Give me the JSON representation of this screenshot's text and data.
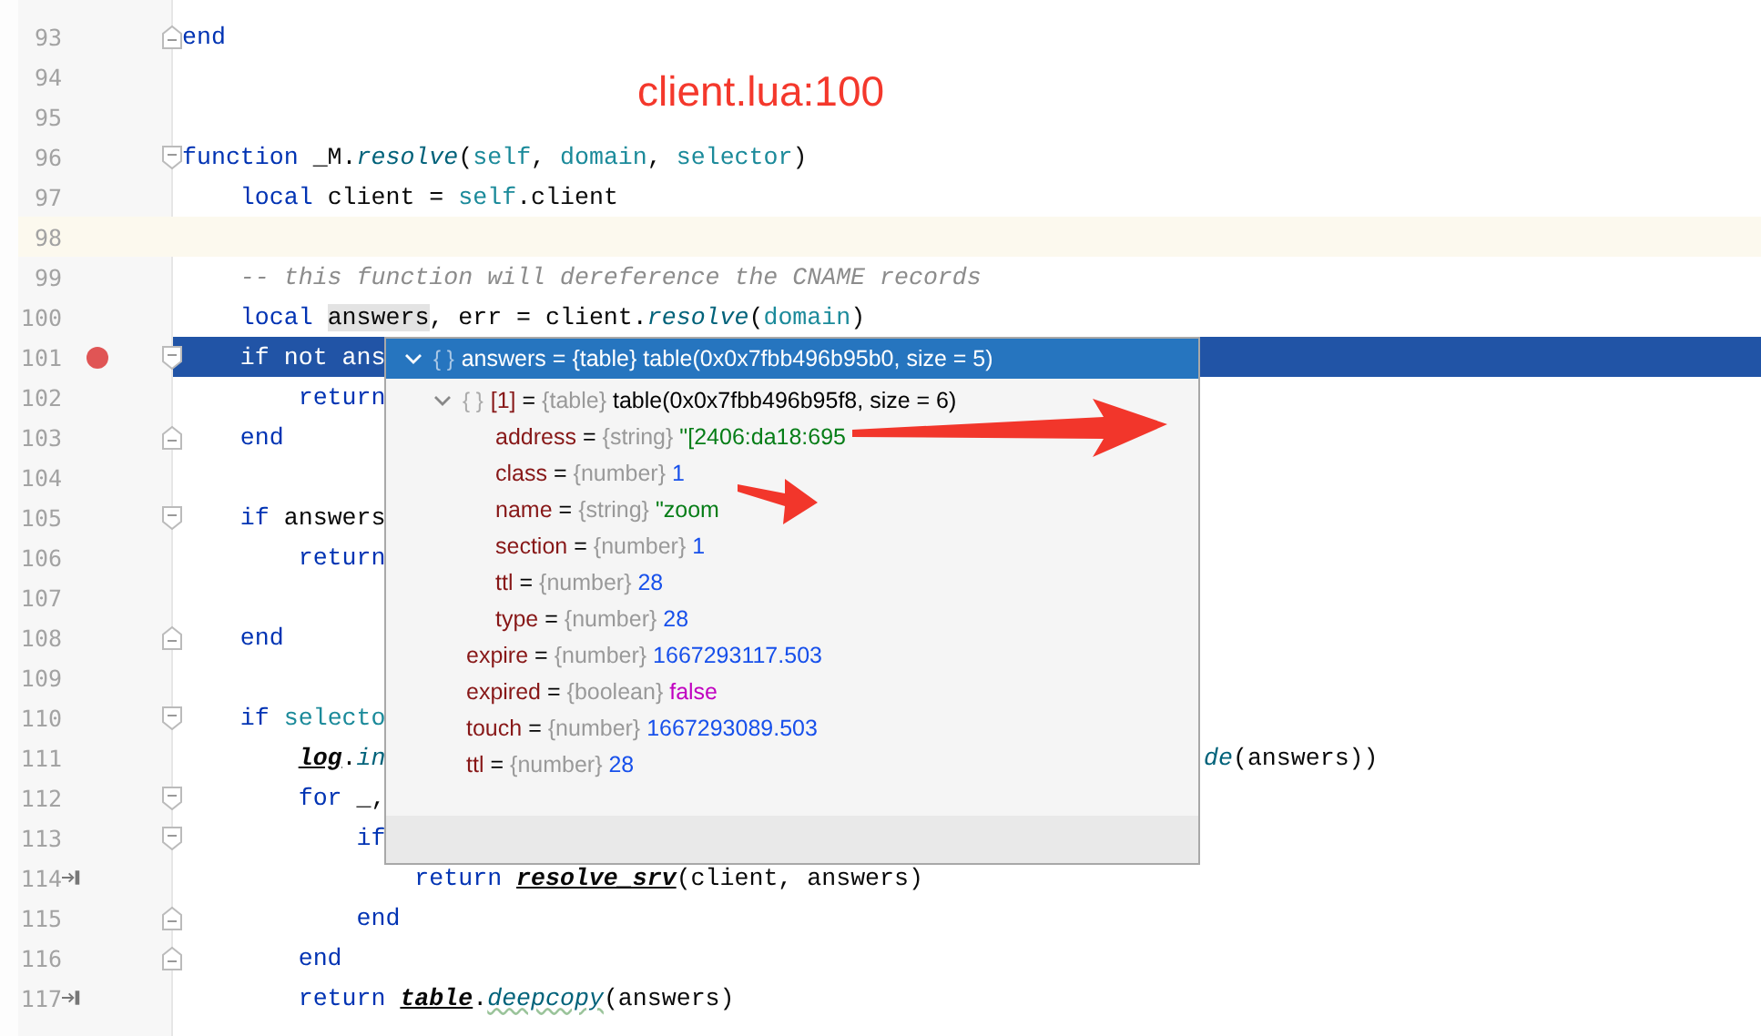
{
  "editor": {
    "lines": [
      {
        "num": "93",
        "kind": "plain",
        "icons": [
          {
            "kind": "fold-end"
          }
        ],
        "tokens": [
          {
            "kind": "kw",
            "text": "end"
          }
        ]
      },
      {
        "num": "94",
        "kind": "plain"
      },
      {
        "num": "95",
        "kind": "plain"
      },
      {
        "num": "96",
        "kind": "plain",
        "icons": [
          {
            "kind": "fold-start"
          }
        ],
        "tokens": [
          {
            "kind": "kw",
            "text": "function "
          },
          {
            "kind": "plain",
            "text": "_M."
          },
          {
            "kind": "fn",
            "text": "resolve"
          },
          {
            "kind": "plain",
            "text": "("
          },
          {
            "kind": "param",
            "text": "self"
          },
          {
            "kind": "plain",
            "text": ", "
          },
          {
            "kind": "param",
            "text": "domain"
          },
          {
            "kind": "plain",
            "text": ", "
          },
          {
            "kind": "param",
            "text": "selector"
          },
          {
            "kind": "plain",
            "text": ")"
          }
        ]
      },
      {
        "num": "97",
        "kind": "plain",
        "tokens": [
          {
            "kind": "kw",
            "text": "    local "
          },
          {
            "kind": "plain",
            "text": "client = "
          },
          {
            "kind": "param",
            "text": "self"
          },
          {
            "kind": "plain",
            "text": ".client"
          }
        ]
      },
      {
        "num": "98",
        "kind": "caret"
      },
      {
        "num": "99",
        "kind": "plain",
        "tokens": [
          {
            "kind": "comment",
            "text": "    -- this function will dereference the CNAME records"
          }
        ]
      },
      {
        "num": "100",
        "kind": "plain",
        "tokens": [
          {
            "kind": "kw",
            "text": "    local "
          },
          {
            "kind": "hl",
            "text": "answers"
          },
          {
            "kind": "plain",
            "text": ", err = client."
          },
          {
            "kind": "fn",
            "text": "resolve"
          },
          {
            "kind": "plain",
            "text": "("
          },
          {
            "kind": "param",
            "text": "domain"
          },
          {
            "kind": "plain",
            "text": ")"
          }
        ]
      },
      {
        "num": "101",
        "kind": "execution",
        "icons": [
          {
            "kind": "breakpoint"
          },
          {
            "kind": "fold-start"
          }
        ],
        "tokens": [
          {
            "kind": "kw",
            "text": "    if not "
          },
          {
            "kind": "plain",
            "text": "ans"
          }
        ]
      },
      {
        "num": "102",
        "kind": "plain",
        "tokens": [
          {
            "kind": "kw",
            "text": "        return"
          }
        ]
      },
      {
        "num": "103",
        "kind": "plain",
        "icons": [
          {
            "kind": "fold-end"
          }
        ],
        "tokens": [
          {
            "kind": "kw",
            "text": "    end"
          }
        ]
      },
      {
        "num": "104",
        "kind": "plain"
      },
      {
        "num": "105",
        "kind": "plain",
        "icons": [
          {
            "kind": "fold-start"
          }
        ],
        "tokens": [
          {
            "kind": "kw",
            "text": "    if "
          },
          {
            "kind": "plain",
            "text": "answers"
          }
        ]
      },
      {
        "num": "106",
        "kind": "plain",
        "tokens": [
          {
            "kind": "kw",
            "text": "        return"
          }
        ]
      },
      {
        "num": "107",
        "kind": "plain"
      },
      {
        "num": "108",
        "kind": "plain",
        "icons": [
          {
            "kind": "fold-end"
          }
        ],
        "tokens": [
          {
            "kind": "kw",
            "text": "    end"
          }
        ]
      },
      {
        "num": "109",
        "kind": "plain"
      },
      {
        "num": "110",
        "kind": "plain",
        "icons": [
          {
            "kind": "fold-start"
          }
        ],
        "tokens": [
          {
            "kind": "kw",
            "text": "    if "
          },
          {
            "kind": "param",
            "text": "selecto"
          }
        ]
      },
      {
        "num": "111",
        "kind": "plain",
        "tokens": [
          {
            "kind": "global",
            "text": "        log"
          },
          {
            "kind": "plain",
            "text": "."
          },
          {
            "kind": "fn",
            "text": "in"
          }
        ],
        "tail": [
          {
            "kind": "fn",
            "text": "de"
          },
          {
            "kind": "plain",
            "text": "(answers))"
          }
        ]
      },
      {
        "num": "112",
        "kind": "plain",
        "icons": [
          {
            "kind": "fold-start"
          }
        ],
        "tokens": [
          {
            "kind": "kw",
            "text": "        for "
          },
          {
            "kind": "plain",
            "text": "_,"
          }
        ]
      },
      {
        "num": "113",
        "kind": "plain",
        "icons": [
          {
            "kind": "fold-start"
          }
        ],
        "tokens": [
          {
            "kind": "kw",
            "text": "            if"
          }
        ]
      },
      {
        "num": "114",
        "kind": "plain",
        "icons": [
          {
            "kind": "run-to"
          }
        ],
        "tokens": [
          {
            "kind": "kw",
            "text": "                return "
          },
          {
            "kind": "global",
            "text": "resolve_srv"
          },
          {
            "kind": "plain",
            "text": "(client, answers)"
          }
        ]
      },
      {
        "num": "115",
        "kind": "plain",
        "icons": [
          {
            "kind": "fold-end"
          }
        ],
        "tokens": [
          {
            "kind": "kw",
            "text": "            end"
          }
        ]
      },
      {
        "num": "116",
        "kind": "plain",
        "icons": [
          {
            "kind": "fold-end"
          }
        ],
        "tokens": [
          {
            "kind": "kw",
            "text": "        end"
          }
        ]
      },
      {
        "num": "117",
        "kind": "plain",
        "icons": [
          {
            "kind": "run-to"
          }
        ],
        "tokens": [
          {
            "kind": "kw",
            "text": "        return "
          },
          {
            "kind": "global",
            "text": "table"
          },
          {
            "kind": "plain",
            "text": "."
          },
          {
            "kind": "warn",
            "text": "deepcopy"
          },
          {
            "kind": "plain",
            "text": "(answers)"
          }
        ]
      }
    ]
  },
  "debug_popup": {
    "items": [
      {
        "name": "answers",
        "assign": "=",
        "type": "{table}",
        "value": "table(0x0x7fbb496b95b0, size = 5)",
        "kind": "table",
        "icon": "{ }",
        "expanded": true,
        "selected": true,
        "children": [
          {
            "name": "[1]",
            "assign": "=",
            "type": "{table}",
            "value": "table(0x0x7fbb496b95f8, size = 6)",
            "kind": "table",
            "icon": "{ }",
            "expanded": true,
            "selected": false,
            "children": [
              {
                "name": "address",
                "assign": "=",
                "type": "{string}",
                "value": "\"[2406:da18:695",
                "kind": "string",
                "selected": false
              },
              {
                "name": "class",
                "assign": "=",
                "type": "{number}",
                "value": "1",
                "kind": "number",
                "selected": false
              },
              {
                "name": "name",
                "assign": "=",
                "type": "{string}",
                "value": "\"zoom",
                "kind": "string",
                "selected": false
              },
              {
                "name": "section",
                "assign": "=",
                "type": "{number}",
                "value": "1",
                "kind": "number",
                "selected": false
              },
              {
                "name": "ttl",
                "assign": "=",
                "type": "{number}",
                "value": "28",
                "kind": "number",
                "selected": false
              },
              {
                "name": "type",
                "assign": "=",
                "type": "{number}",
                "value": "28",
                "kind": "number",
                "selected": false
              }
            ]
          },
          {
            "name": "expire",
            "assign": "=",
            "type": "{number}",
            "value": "1667293117.503",
            "kind": "number",
            "selected": false
          },
          {
            "name": "expired",
            "assign": "=",
            "type": "{boolean}",
            "value": "false",
            "kind": "boolean",
            "selected": false
          },
          {
            "name": "touch",
            "assign": "=",
            "type": "{number}",
            "value": "1667293089.503",
            "kind": "number",
            "selected": false
          },
          {
            "name": "ttl",
            "assign": "=",
            "type": "{number}",
            "value": "28",
            "kind": "number",
            "selected": false
          }
        ]
      }
    ]
  },
  "annotation": {
    "text": "client.lua:100",
    "arrows": [
      {
        "kind": "arrow"
      },
      {
        "kind": "arrow"
      }
    ]
  }
}
